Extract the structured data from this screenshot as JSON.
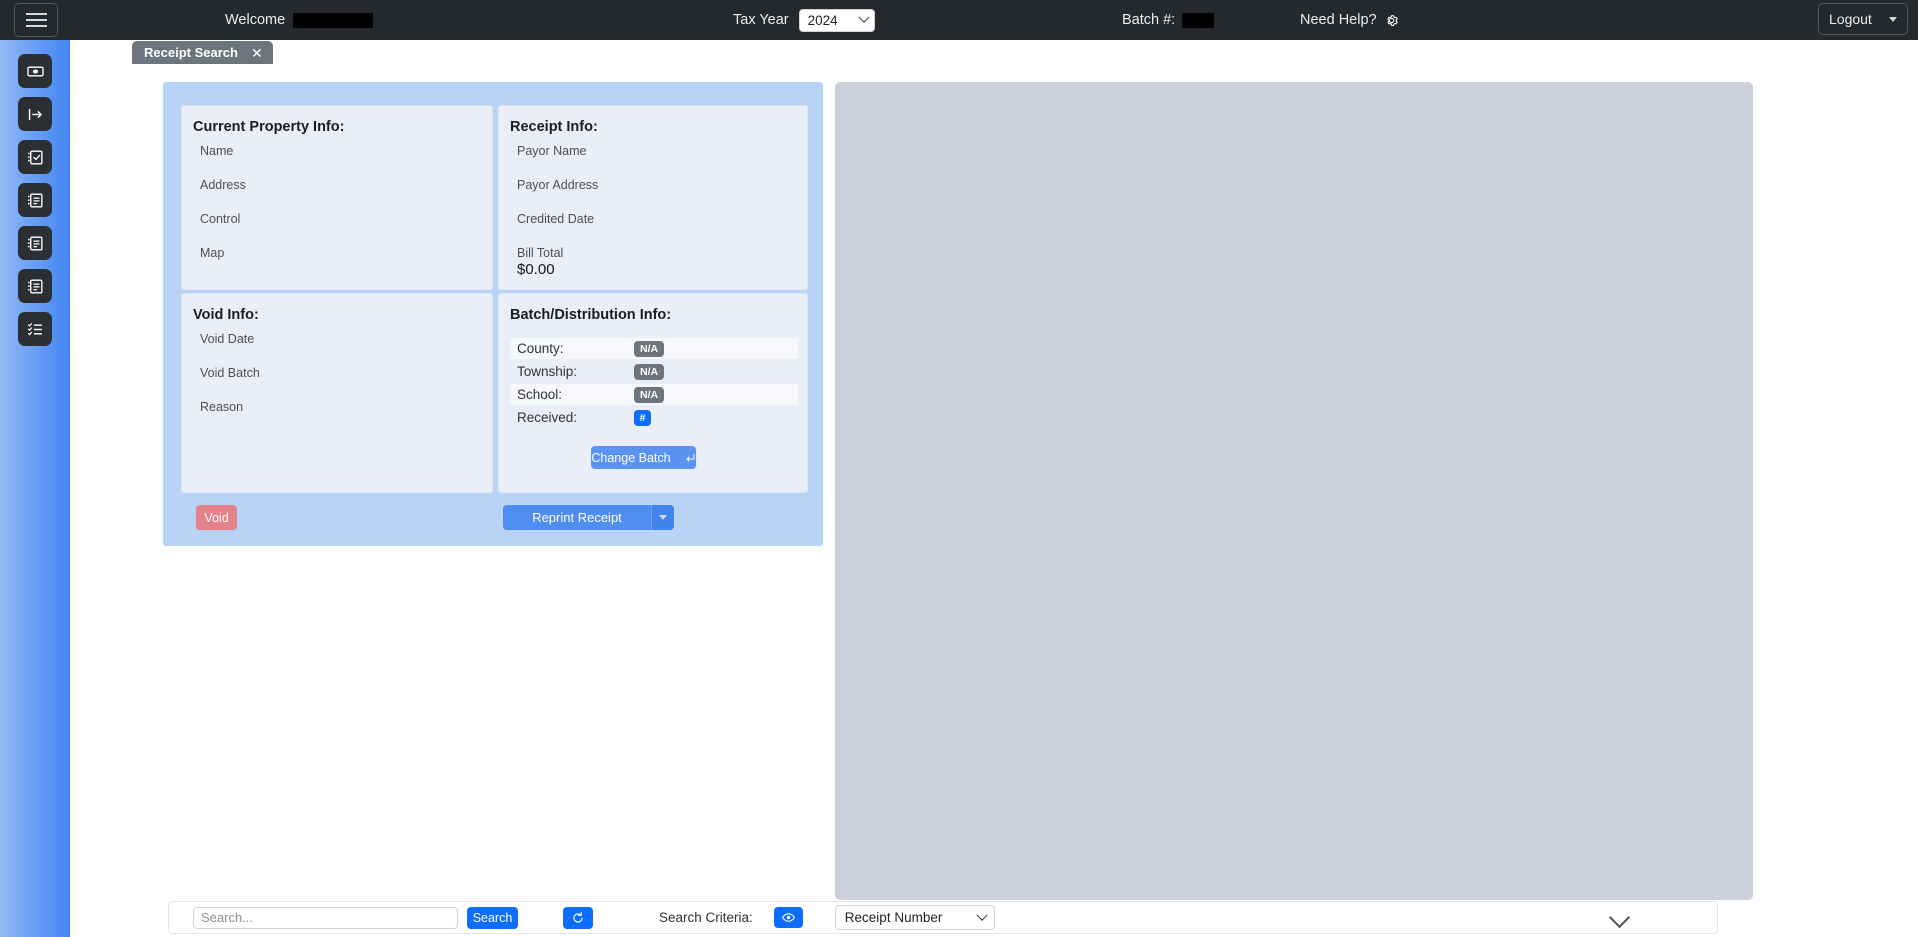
{
  "topbar": {
    "menu_icon": "hamburger-icon",
    "welcome_label": "Welcome",
    "welcome_value_redacted": "",
    "tax_year_label": "Tax Year",
    "tax_year_value": "2024",
    "batch_label": "Batch #:",
    "batch_value_redacted": "",
    "help_label": "Need Help?",
    "help_icon": "gear-icon",
    "logout_label": "Logout"
  },
  "sidebar": {
    "items": [
      {
        "icon": "cash-bill-icon",
        "name": "sidebar-item-payments"
      },
      {
        "icon": "arrow-right-exit-icon",
        "name": "sidebar-item-distribution"
      },
      {
        "icon": "clipboard-check-icon",
        "name": "sidebar-item-tasks"
      },
      {
        "icon": "document-list-icon-1",
        "name": "sidebar-item-reports-1"
      },
      {
        "icon": "document-list-icon-2",
        "name": "sidebar-item-reports-2"
      },
      {
        "icon": "document-list-icon-3",
        "name": "sidebar-item-reports-3"
      },
      {
        "icon": "checklist-icon",
        "name": "sidebar-item-checklist"
      }
    ]
  },
  "tab": {
    "label": "Receipt Search",
    "close_icon": "close-icon"
  },
  "property_info": {
    "title": "Current Property Info:",
    "fields": [
      {
        "label": "Name",
        "value": ""
      },
      {
        "label": "Address",
        "value": ""
      },
      {
        "label": "Control",
        "value": ""
      },
      {
        "label": "Map",
        "value": ""
      }
    ]
  },
  "receipt_info": {
    "title": "Receipt Info:",
    "fields": [
      {
        "label": "Payor Name",
        "value": ""
      },
      {
        "label": "Payor Address",
        "value": ""
      },
      {
        "label": "Credited Date",
        "value": ""
      },
      {
        "label": "Bill Total",
        "value": "$0.00"
      }
    ]
  },
  "void_info": {
    "title": "Void Info:",
    "fields": [
      {
        "label": "Void Date",
        "value": ""
      },
      {
        "label": "Void Batch",
        "value": ""
      },
      {
        "label": "Reason",
        "value": ""
      }
    ]
  },
  "batch_info": {
    "title": "Batch/Distribution Info:",
    "rows": [
      {
        "label": "County:",
        "badge": "N/A",
        "badge_type": "na"
      },
      {
        "label": "Township:",
        "badge": "N/A",
        "badge_type": "na"
      },
      {
        "label": "School:",
        "badge": "N/A",
        "badge_type": "na"
      },
      {
        "label": "Received:",
        "badge": "#",
        "badge_type": "hash"
      }
    ],
    "change_batch_label": "Change Batch",
    "change_batch_icon": "enter-return-icon"
  },
  "actions": {
    "void_label": "Void",
    "reprint_label": "Reprint Receipt",
    "reprint_caret_icon": "caret-down-icon"
  },
  "search": {
    "placeholder": "Search...",
    "value": "",
    "search_button": "Search",
    "refresh_icon": "refresh-icon",
    "criteria_label": "Search Criteria:",
    "eye_icon": "eye-icon",
    "criteria_value": "Receipt Number",
    "expand_icon": "chevron-down-icon"
  },
  "colors": {
    "topbar_bg": "#25282c",
    "sidebar_blue": "#4386f3",
    "card_blue": "#b8d3f5",
    "panel_bg": "#e9eef8",
    "gray_panel": "#ccd1dc",
    "primary_blue": "#0d6efd",
    "void_red": "#e4818a",
    "badge_gray": "#6c757d",
    "tab_gray": "#6c757d"
  }
}
